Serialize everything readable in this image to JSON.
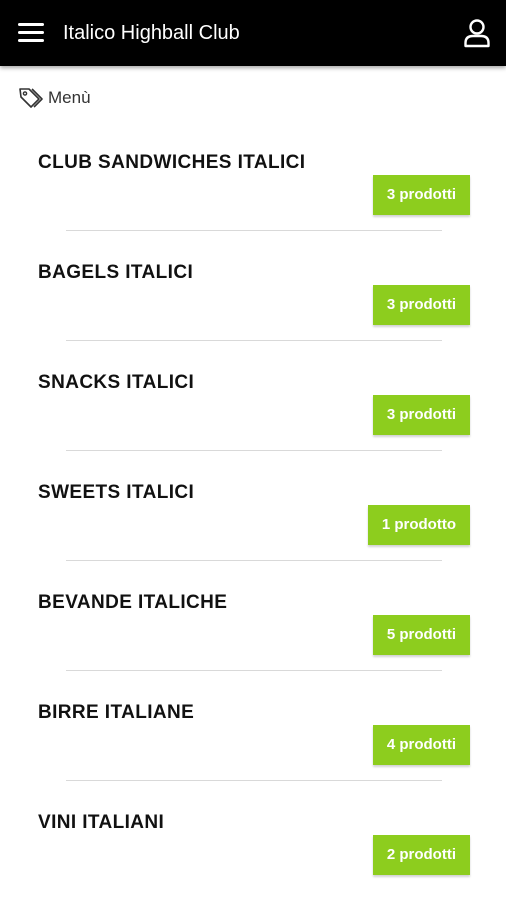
{
  "header": {
    "title": "Italico Highball Club",
    "menu_icon": "hamburger-menu-icon",
    "account_icon": "user-icon"
  },
  "breadcrumb": {
    "icon": "tag-icon",
    "label": "Menù"
  },
  "categories": [
    {
      "name": "CLUB SANDWICHES ITALICI",
      "count_label": "3 prodotti"
    },
    {
      "name": "BAGELS ITALICI",
      "count_label": "3 prodotti"
    },
    {
      "name": "SNACKS ITALICI",
      "count_label": "3 prodotti"
    },
    {
      "name": "SWEETS ITALICI",
      "count_label": "1 prodotto"
    },
    {
      "name": "BEVANDE ITALICHE",
      "count_label": "5 prodotti"
    },
    {
      "name": "BIRRE ITALIANE",
      "count_label": "4 prodotti"
    },
    {
      "name": "VINI ITALIANI",
      "count_label": "2 prodotti"
    }
  ],
  "colors": {
    "header_bg": "#000000",
    "badge_bg": "#8dcd1e",
    "divider": "#d9d9d9"
  }
}
